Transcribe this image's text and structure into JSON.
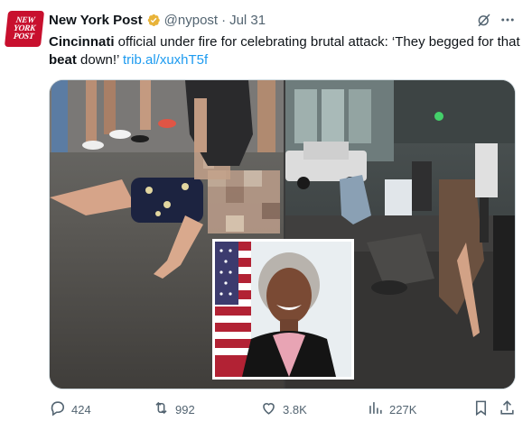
{
  "tweet": {
    "avatar_text": [
      "NEW",
      "YORK",
      "POST"
    ],
    "display_name": "New York Post",
    "handle": "@nypost",
    "separator": "·",
    "timestamp": "Jul 31",
    "text_bold_1": "Cincinnati",
    "text_1": " official under fire for celebrating brutal attack: ‘They begged for that ",
    "text_bold_2": "beat",
    "text_2": " down!’ ",
    "link": "trib.al/xuxhT5f"
  },
  "media": {
    "description_left": "street-fight-photo-left",
    "description_right": "street-fight-photo-right",
    "inset": "official-portrait-inset"
  },
  "actions": {
    "replies": "424",
    "reposts": "992",
    "likes": "3.8K",
    "views": "227K"
  },
  "icons": {
    "verified": "verified-gold-badge-icon",
    "grok": "grok-icon",
    "more": "more-icon",
    "reply": "reply-icon",
    "repost": "repost-icon",
    "like": "like-icon",
    "views": "views-icon",
    "bookmark": "bookmark-icon",
    "share": "share-icon"
  },
  "colors": {
    "brand_red": "#c8102e",
    "link": "#1d9bf0",
    "muted": "#536471",
    "verified_gold": "#e8b339"
  }
}
